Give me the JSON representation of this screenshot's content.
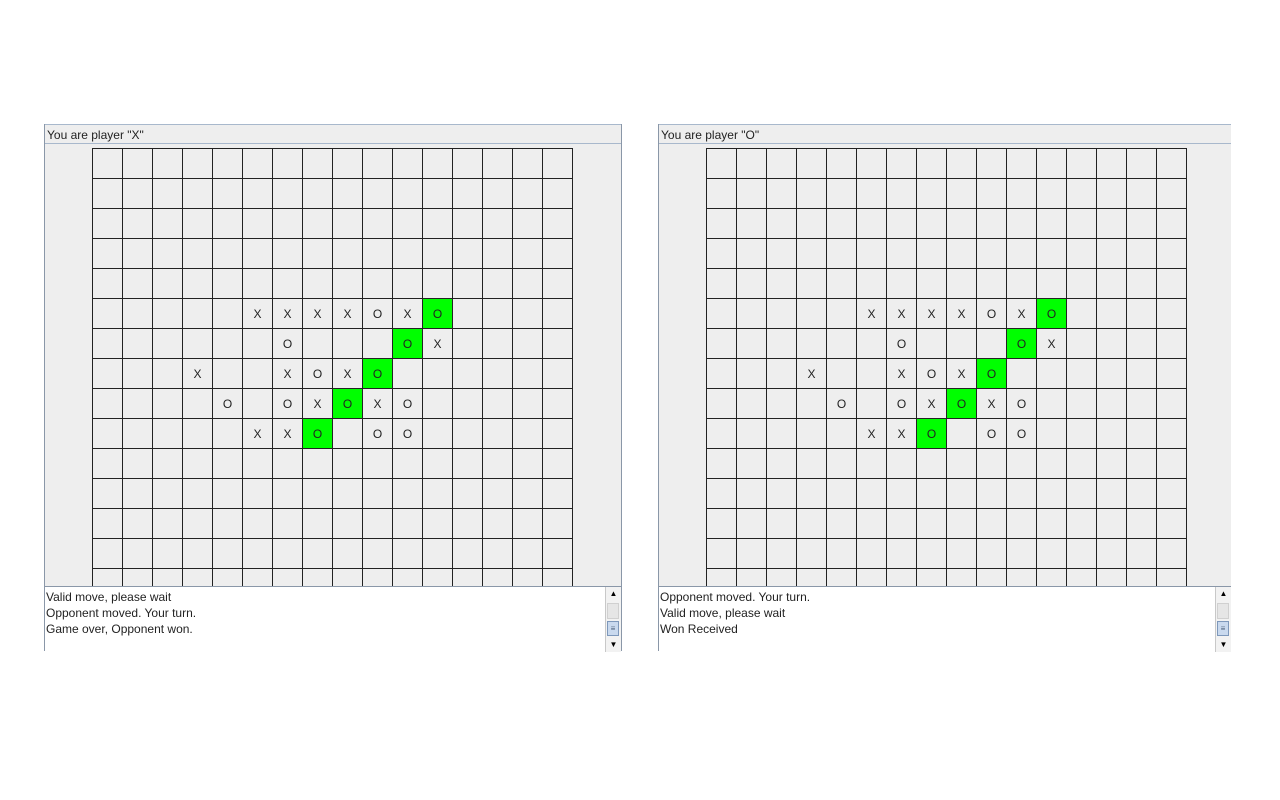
{
  "win_color": "#00ff00",
  "windows": [
    {
      "id": "x",
      "title": "You are player \"X\"",
      "log": [
        "Valid move, please wait",
        "Opponent moved. Your turn.",
        "Game over, Opponent won."
      ]
    },
    {
      "id": "o",
      "title": "You are player \"O\"",
      "log": [
        "Opponent moved. Your turn.",
        "Valid move, please wait",
        "Won Received"
      ]
    }
  ],
  "board": {
    "columns": 16,
    "rows": 15,
    "marks": [
      [
        5,
        5,
        "X"
      ],
      [
        5,
        6,
        "X"
      ],
      [
        5,
        7,
        "X"
      ],
      [
        5,
        8,
        "X"
      ],
      [
        5,
        9,
        "O"
      ],
      [
        5,
        10,
        "X"
      ],
      [
        5,
        11,
        "O"
      ],
      [
        6,
        6,
        "O"
      ],
      [
        6,
        10,
        "O"
      ],
      [
        6,
        11,
        "X"
      ],
      [
        7,
        3,
        "X"
      ],
      [
        7,
        6,
        "X"
      ],
      [
        7,
        7,
        "O"
      ],
      [
        7,
        8,
        "X"
      ],
      [
        7,
        9,
        "O"
      ],
      [
        8,
        4,
        "O"
      ],
      [
        8,
        6,
        "O"
      ],
      [
        8,
        7,
        "X"
      ],
      [
        8,
        8,
        "O"
      ],
      [
        8,
        9,
        "X"
      ],
      [
        8,
        10,
        "O"
      ],
      [
        9,
        5,
        "X"
      ],
      [
        9,
        6,
        "X"
      ],
      [
        9,
        7,
        "O"
      ],
      [
        9,
        9,
        "O"
      ],
      [
        9,
        10,
        "O"
      ]
    ],
    "winning_cells": [
      [
        5,
        11
      ],
      [
        6,
        10
      ],
      [
        7,
        9
      ],
      [
        8,
        8
      ],
      [
        9,
        7
      ]
    ]
  },
  "scrollbar": {
    "up_icon": "arrow-up-icon",
    "down_icon": "arrow-down-icon",
    "thumb_icon": "grip-icon"
  }
}
